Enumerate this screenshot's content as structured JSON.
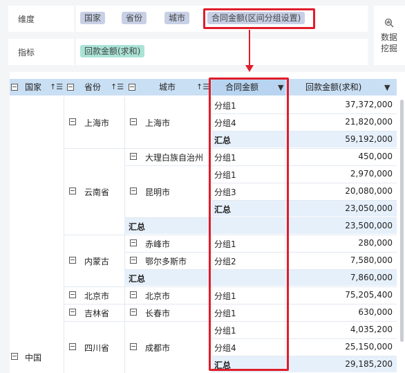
{
  "config": {
    "dimension_label": "维度",
    "indicator_label": "指标",
    "dimensions": [
      "国家",
      "省份",
      "城市",
      "合同金额(区间分组设置)"
    ],
    "indicators": [
      "回款金额(求和)"
    ],
    "side_button_line1": "数据",
    "side_button_line2": "挖掘"
  },
  "table": {
    "headers": {
      "country": "国家",
      "province": "省份",
      "city": "城市",
      "contract": "合同金额",
      "payment": "回款金额(求和)"
    },
    "country_value": "中国",
    "provinces": [
      {
        "name": "上海市"
      },
      {
        "name": "云南省"
      },
      {
        "name": "内蒙古"
      },
      {
        "name": "北京市"
      },
      {
        "name": "吉林省"
      },
      {
        "name": "四川省"
      }
    ],
    "cities": [
      {
        "name": "上海市"
      },
      {
        "name": "大理白族自治州"
      },
      {
        "name": "昆明市"
      },
      {
        "name": "赤峰市"
      },
      {
        "name": "鄂尔多斯市"
      },
      {
        "name": "北京市"
      },
      {
        "name": "长春市"
      },
      {
        "name": "成都市"
      }
    ],
    "rows": [
      {
        "group": "分组1",
        "value": "37,372,000"
      },
      {
        "group": "分组4",
        "value": "21,820,000"
      },
      {
        "group": "汇总",
        "value": "59,192,000"
      },
      {
        "group": "分组1",
        "value": "450,000"
      },
      {
        "group": "分组1",
        "value": "2,970,000"
      },
      {
        "group": "分组3",
        "value": "20,080,000"
      },
      {
        "group": "汇总",
        "value": "23,050,000"
      },
      {
        "group": "",
        "value": "23,500,000",
        "subtotal": "汇总"
      },
      {
        "group": "分组1",
        "value": "280,000"
      },
      {
        "group": "分组2",
        "value": "7,580,000"
      },
      {
        "group": "",
        "value": "7,860,000",
        "subtotal": "汇总"
      },
      {
        "group": "分组1",
        "value": "75,205,400"
      },
      {
        "group": "分组1",
        "value": "630,000"
      },
      {
        "group": "分组1",
        "value": "4,035,200"
      },
      {
        "group": "分组4",
        "value": "25,150,000"
      },
      {
        "group": "汇总",
        "value": "29,185,200"
      }
    ]
  }
}
